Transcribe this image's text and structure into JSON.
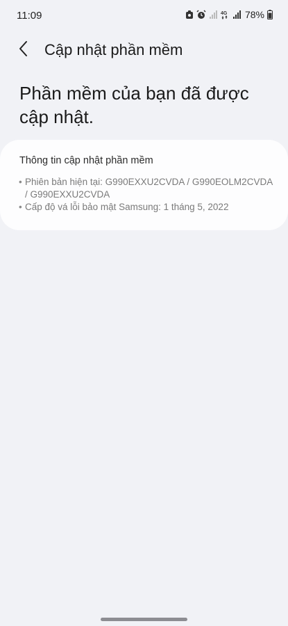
{
  "status_bar": {
    "time": "11:09",
    "battery_percent": "78%",
    "network_type": "4G",
    "icons": [
      "gallery-notification-icon",
      "alarm-icon",
      "signal-icon",
      "network-4g-icon",
      "signal-icon",
      "battery-icon"
    ]
  },
  "header": {
    "back_icon": "chevron-left-icon",
    "title": "Cập nhật phần mềm"
  },
  "main": {
    "status_message": "Phần mềm của bạn đã được cập nhật."
  },
  "info_card": {
    "title": "Thông tin cập nhật phần mềm",
    "items": [
      "Phiên bản hiện tại: G990EXXU2CVDA / G990EOLM2CVDA / G990EXXU2CVDA",
      "Cấp độ vá lỗi bảo mật Samsung: 1 tháng 5, 2022"
    ]
  },
  "colors": {
    "background": "#f1f2f6",
    "card": "#fdfdfe",
    "text_primary": "#1a1a1a",
    "text_secondary": "#7a7a7a"
  }
}
